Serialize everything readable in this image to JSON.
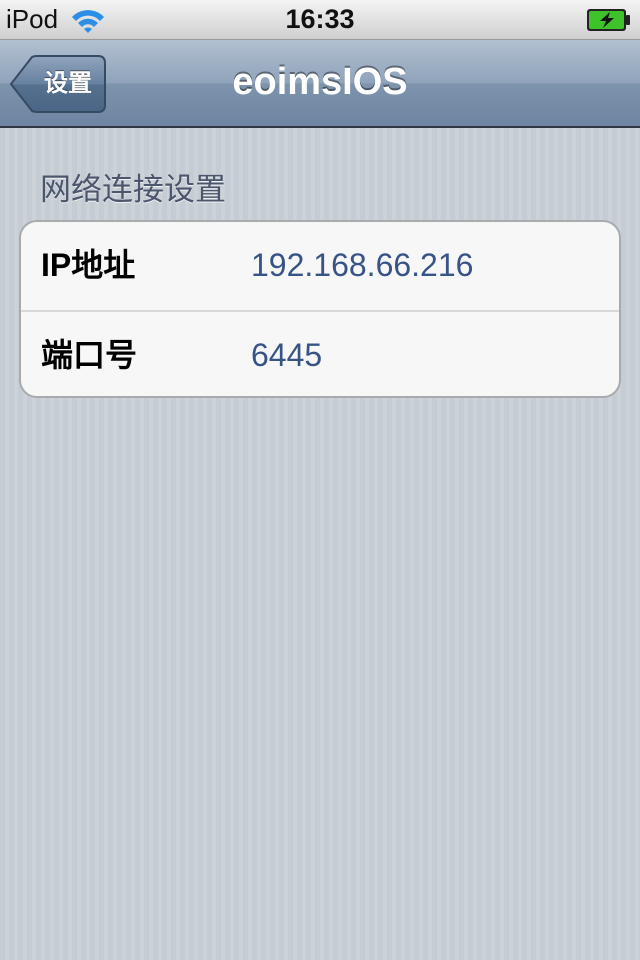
{
  "status_bar": {
    "carrier": "iPod",
    "time": "16:33",
    "wifi_icon": "wifi-icon",
    "battery_icon": "battery-charging-icon",
    "battery_color": "#3fc32b"
  },
  "nav_bar": {
    "back_label": "设置",
    "title": "eoimsIOS"
  },
  "section": {
    "header": "网络连接设置",
    "rows": [
      {
        "label": "IP地址",
        "value": "192.168.66.216"
      },
      {
        "label": "端口号",
        "value": "6445"
      }
    ]
  },
  "colors": {
    "nav_bar": "#6d85a1",
    "value_text": "#385487",
    "section_header": "#4c566c",
    "background": "#c5ccd4"
  }
}
